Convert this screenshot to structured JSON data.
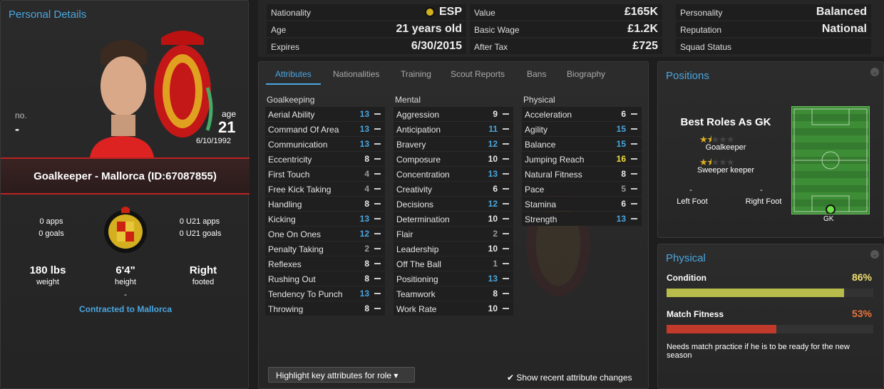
{
  "personal": {
    "title": "Personal Details",
    "no_label": "no.",
    "no_value": "-",
    "age_label": "age",
    "age_value": "21",
    "dob": "6/10/1992",
    "role_line": "Goalkeeper - Mallorca (ID:67087855)",
    "apps": "0 apps",
    "goals": "0 goals",
    "u21_apps": "0 U21 apps",
    "u21_goals": "0 U21 goals",
    "weight_value": "180 lbs",
    "weight_label": "weight",
    "height_value": "6'4\"",
    "height_label": "height",
    "foot_value": "Right",
    "foot_label": "footed",
    "dash": "-",
    "contract": "Contracted to Mallorca"
  },
  "top": {
    "nationality_label": "Nationality",
    "nationality_value": "ESP",
    "age_label": "Age",
    "age_value": "21 years old",
    "expires_label": "Expires",
    "expires_value": "6/30/2015",
    "value_label": "Value",
    "value_value": "£165K",
    "wage_label": "Basic Wage",
    "wage_value": "£1.2K",
    "tax_label": "After Tax",
    "tax_value": "£725",
    "personality_label": "Personality",
    "personality_value": "Balanced",
    "reputation_label": "Reputation",
    "reputation_value": "National",
    "squad_label": "Squad Status",
    "squad_value": ""
  },
  "tabs": [
    "Attributes",
    "Nationalities",
    "Training",
    "Scout Reports",
    "Bans",
    "Biography"
  ],
  "categories": {
    "gk": "Goalkeeping",
    "mental": "Mental",
    "physical": "Physical"
  },
  "gk": [
    [
      "Aerial Ability",
      "13"
    ],
    [
      "Command Of Area",
      "13"
    ],
    [
      "Communication",
      "13"
    ],
    [
      "Eccentricity",
      "8"
    ],
    [
      "First Touch",
      "4"
    ],
    [
      "Free Kick Taking",
      "4"
    ],
    [
      "Handling",
      "8"
    ],
    [
      "Kicking",
      "13"
    ],
    [
      "One On Ones",
      "12"
    ],
    [
      "Penalty Taking",
      "2"
    ],
    [
      "Reflexes",
      "8"
    ],
    [
      "Rushing Out",
      "8"
    ],
    [
      "Tendency To Punch",
      "13"
    ],
    [
      "Throwing",
      "8"
    ]
  ],
  "mental": [
    [
      "Aggression",
      "9"
    ],
    [
      "Anticipation",
      "11"
    ],
    [
      "Bravery",
      "12"
    ],
    [
      "Composure",
      "10"
    ],
    [
      "Concentration",
      "13"
    ],
    [
      "Creativity",
      "6"
    ],
    [
      "Decisions",
      "12"
    ],
    [
      "Determination",
      "10"
    ],
    [
      "Flair",
      "2"
    ],
    [
      "Leadership",
      "10"
    ],
    [
      "Off The Ball",
      "1"
    ],
    [
      "Positioning",
      "13"
    ],
    [
      "Teamwork",
      "8"
    ],
    [
      "Work Rate",
      "10"
    ]
  ],
  "physical": [
    [
      "Acceleration",
      "6"
    ],
    [
      "Agility",
      "15"
    ],
    [
      "Balance",
      "15"
    ],
    [
      "Jumping Reach",
      "16"
    ],
    [
      "Natural Fitness",
      "8"
    ],
    [
      "Pace",
      "5"
    ],
    [
      "Stamina",
      "6"
    ],
    [
      "Strength",
      "13"
    ]
  ],
  "colors": {
    "white": "#e8e8e8",
    "blue": "#4aa6e0",
    "yellow": "#f0e040",
    "grey": "#999999"
  },
  "highlight_btn": "Highlight key attributes for role",
  "show_recent": "Show recent attribute changes",
  "positions": {
    "title": "Positions",
    "best_roles": "Best Roles As GK",
    "role1": "Goalkeeper",
    "role2": "Sweeper keeper",
    "left_foot_label": "Left Foot",
    "left_foot_value": "-",
    "right_foot_label": "Right Foot",
    "right_foot_value": "-",
    "gk": "GK",
    "role1_stars": 1.5,
    "role2_stars": 1.5
  },
  "physical_panel": {
    "title": "Physical",
    "condition_label": "Condition",
    "condition_value": "86%",
    "condition": 0.86,
    "fitness_label": "Match Fitness",
    "fitness_value": "53%",
    "fitness": 0.53,
    "note": "Needs match practice if he is to be ready for the new season",
    "condition_color": "#b8bc4a",
    "fitness_color": "#c23a2a",
    "condition_text_color": "#f2e070",
    "fitness_text_color": "#e8753a"
  }
}
